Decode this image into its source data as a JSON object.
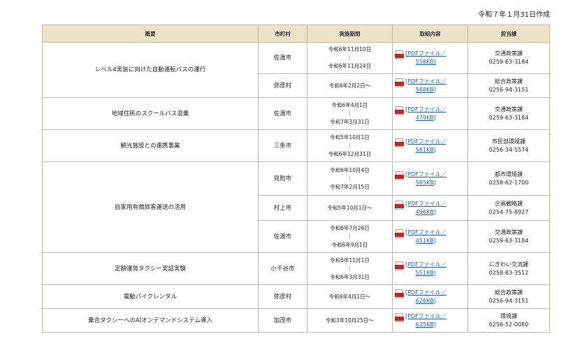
{
  "created_date": "令和７年１月31日作成",
  "headers": [
    "概要",
    "市町村",
    "実施期間",
    "取組内容",
    "担当課"
  ],
  "pdf_icon": "pdf-file-icon",
  "groups": [
    {
      "summary": "レベル4実装に向けた自動運転バスの運行",
      "rows": [
        {
          "muni": "佐渡市",
          "period": [
            "令和6年11月10日",
            "｜",
            "令和6年11月24日"
          ],
          "pdf": [
            "[PDFファイル／",
            "558KB]"
          ],
          "dept": [
            "交通政策課",
            "0259-63-3184"
          ]
        },
        {
          "muni": "弥彦村",
          "period": [
            "令和6年2月2日～"
          ],
          "pdf": [
            "[PDFファイル／",
            "568KB]"
          ],
          "dept": [
            "総合政策課",
            "0256-94-3151"
          ]
        }
      ]
    },
    {
      "summary": "地域住民のスクールバス混乗",
      "rows": [
        {
          "muni": "佐渡市",
          "period": [
            "令和6年4月1日",
            "｜",
            "令和7年3月31日"
          ],
          "pdf": [
            "[PDFファイル／",
            "479KB]"
          ],
          "dept": [
            "交通政策課",
            "0259-63-3184"
          ]
        }
      ]
    },
    {
      "summary": "観光施設との連携事業",
      "rows": [
        {
          "muni": "三条市",
          "period": [
            "令和5年10月1日",
            "｜",
            "令和6年12月31日"
          ],
          "pdf": [
            "[PDFファイル／",
            "581KB]"
          ],
          "dept": [
            "市民部環境課",
            "0256-34-5574"
          ]
        }
      ]
    },
    {
      "summary": "自家用有償旅客運送の活用",
      "rows": [
        {
          "muni": "見附市",
          "period": [
            "令和6年10月4日",
            "｜",
            "令和7年2月15日"
          ],
          "pdf": [
            "[PDFファイル／",
            "585KB]"
          ],
          "dept": [
            "都市環境課",
            "0258-62-1700"
          ]
        },
        {
          "muni": "村上市",
          "period": [
            "令和5年10月1日～"
          ],
          "pdf": [
            "[PDFファイル／",
            "496KB]"
          ],
          "dept": [
            "企画戦略課",
            "0254-75-8927"
          ]
        },
        {
          "muni": "佐渡市",
          "period": [
            "令和6年7月26日",
            "｜",
            "令和6年9月1日"
          ],
          "pdf": [
            "[PDFファイル／",
            "451KB]"
          ],
          "dept": [
            "交通政策課",
            "0259-63-3184"
          ]
        }
      ]
    },
    {
      "summary": "定額運賃タクシー実証実験",
      "rows": [
        {
          "muni": "小千谷市",
          "period": [
            "令和5年11月1日",
            "｜",
            "令和6年3月31日"
          ],
          "pdf": [
            "[PDFファイル／",
            "551KB]"
          ],
          "dept": [
            "にぎわい交流課",
            "0258-83-3512"
          ]
        }
      ]
    },
    {
      "summary": "電動バイクレンタル",
      "rows": [
        {
          "muni": "弥彦村",
          "period": [
            "令和6年4月1日～"
          ],
          "pdf": [
            "[PDFファイル／",
            "626KB]"
          ],
          "dept": [
            "総合政策課",
            "0256-94-3151"
          ]
        }
      ]
    },
    {
      "summary": "乗合タクシーへのAIオンデマンドシステム導入",
      "rows": [
        {
          "muni": "加茂市",
          "period": [
            "令和3年10月25日～"
          ],
          "pdf": [
            "[PDFファイル／",
            "635KB]"
          ],
          "dept": [
            "環境課",
            "0256-52-0080"
          ]
        }
      ]
    }
  ]
}
